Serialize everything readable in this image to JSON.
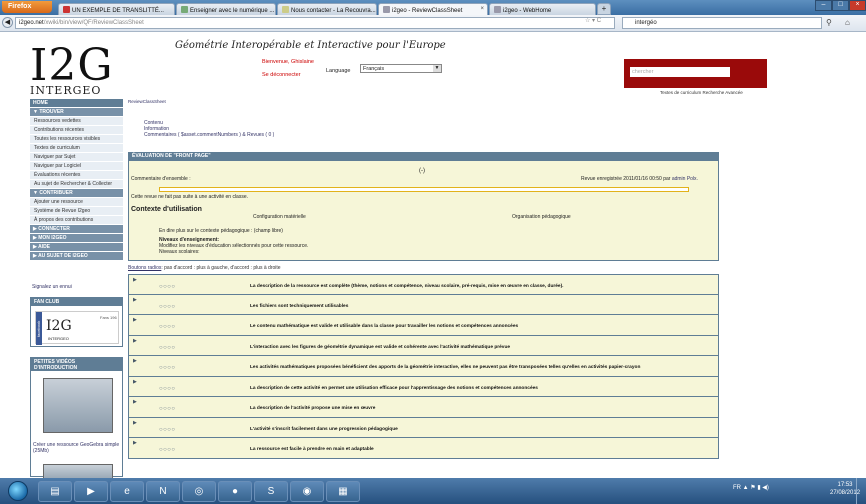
{
  "browser": {
    "app_button": "Firefox",
    "tabs": [
      {
        "label": "UN EXEMPLE DE TRANSLITTÉ...",
        "active": false
      },
      {
        "label": "Enseigner avec le numérique ...",
        "active": false
      },
      {
        "label": "Nous contacter - La Recouvra...",
        "active": false
      },
      {
        "label": "i2geo - ReviewClassSheet",
        "active": true
      },
      {
        "label": "i2geo - WebHome",
        "active": false
      }
    ],
    "new_tab": "+",
    "url_host": "i2geo.net",
    "url_path": "/xwiki/bin/view/QF/ReviewClassSheet",
    "search_value": "intergéo"
  },
  "header": {
    "logo": "I2G",
    "logo_sub": "INTERGEO",
    "site_title": "Géométrie Interopérable et Interactive pour l'Europe",
    "welcome": "Bienvenue, Ghislaine",
    "logout": "Se déconnecter",
    "language_label": "Language",
    "language_value": "Français",
    "search_placeholder": "chercher",
    "links": "Textes de curriculum  Recherche Avancée"
  },
  "sidebar": {
    "home": "HOME",
    "trouver": "TROUVER",
    "trouver_items": [
      "Ressources vedettes",
      "Contributions récentes",
      "Toutes les ressources visibles",
      "Textes de curriculum",
      "Naviguer par Sujet",
      "Naviguer par Logiciel",
      "Évaluations récentes",
      "Au sujet de Rechercher & Collecter"
    ],
    "contribuer": "CONTRIBUER",
    "contribuer_items": [
      "Ajouter une ressource",
      "Système de Revue I2geo",
      "À propos des contributions"
    ],
    "connecter": "CONNECTER",
    "mon_i2geo": "MON I2GEO",
    "aide": "AIDE",
    "au_sujet": "AU SUJET DE I2GEO",
    "signal": "Signalez un ennui",
    "fan_club": "FAN CLUB",
    "fan_logo": "I2G",
    "fan_sub": "INTERGEO",
    "fan_fans": "Fans",
    "fan_count": "196",
    "videos_title": "PETITES VIDÉOS D'INTRODUCTION",
    "video_caption": "Créer une ressource GeoGebra simple (25Mb)"
  },
  "main": {
    "breadcrumb": "ReviewClassSheet",
    "toc": [
      "Contenu",
      "Information",
      "Commentaires ( $asset.commentNumbers ) & Revues ( 0 )"
    ],
    "eval_header": "ÉVALUATION DE \"FRONT PAGE\"",
    "overall_label": "Commentaire d'ensemble :",
    "overall_score": "(-)",
    "review_date": "Revue enregistrée 2011/01/16 00:50 par",
    "reviewer": "admin Polx.",
    "notice": "Cette revue ne fait pas suite à une activité en classe.",
    "context_title": "Contexte d'utilisation",
    "config_label": "Configuration matérielle",
    "org_label": "Organisation pédagogique",
    "more_label": "En dire plus sur le contexte pédagogique : (champ libre)",
    "levels_header": "Niveaux d'enseignement:",
    "levels_modified": "Modifiez les niveaux d'éducation sélectionnés pour cette ressource.",
    "levels_school": "Niveaux scolaires:",
    "radio_hint_link": "Boutons radios",
    "radio_hint_rest": ": pas d'accord : plus à gauche, d'accord : plus à droite",
    "criteria": [
      "La description de la ressource est complète (thème, notions et compétence, niveau scolaire, pré-requis, mise en œuvre en classe, durée).",
      "Les fichiers sont techniquement utilisables",
      "Le contenu mathématique est valide et utilisable dans la classe pour travailler les notions et compétences annoncées",
      "L'interaction avec les figures de géométrie dynamique est valide et cohérente avec l'activité mathématique prévue",
      "Les activités mathématiques proposées bénéficient des apports de la géométrie interactive, elles ne peuvent pas être transposées telles qu'elles en activités papier-crayon",
      "La description de cette activité en permet une utilisation efficace pour l'apprentissage des notions et compétences annoncées",
      "La description de l'activité propose une mise en œuvre",
      "L'activité s'inscrit facilement dans une progression pédagogique",
      "La ressource est facile à prendre en main et adaptable"
    ],
    "stars": "○○○○"
  },
  "taskbar": {
    "lang": "FR",
    "time": "17:53",
    "date": "27/08/2012"
  },
  "colors": {
    "sidebar_header": "#5f7d95",
    "search_box": "#9a0a0a",
    "eval_bg": "#f6f6d8"
  }
}
